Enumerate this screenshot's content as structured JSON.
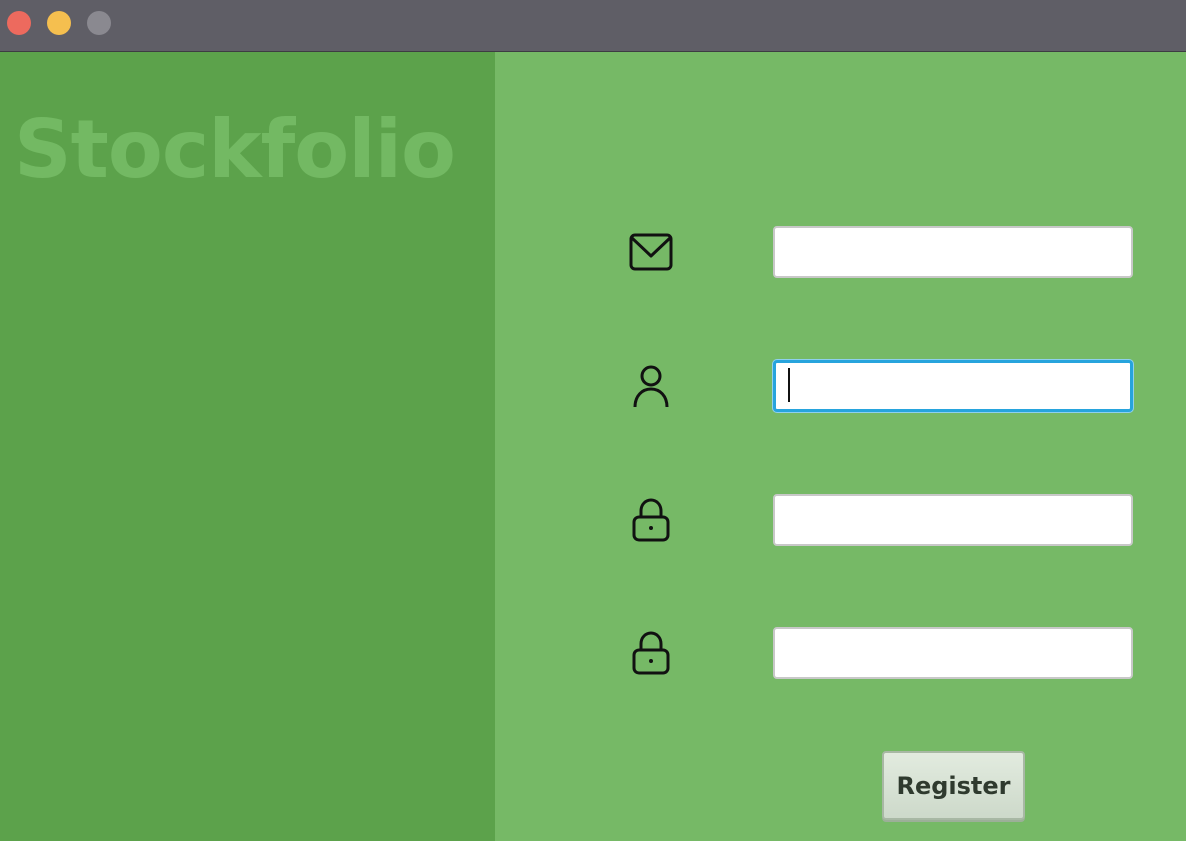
{
  "window": {
    "controls": [
      {
        "name": "close",
        "color": "#ed6a5e"
      },
      {
        "name": "minimize",
        "color": "#f5bf4f"
      },
      {
        "name": "zoom",
        "color": "#8a8990"
      }
    ]
  },
  "brand": {
    "title": "Stockfolio"
  },
  "form": {
    "fields": [
      {
        "icon": "envelope-icon",
        "value": "",
        "focused": false
      },
      {
        "icon": "user-icon",
        "value": "",
        "focused": true
      },
      {
        "icon": "lock-icon",
        "value": "",
        "focused": false
      },
      {
        "icon": "lock-icon",
        "value": "",
        "focused": false
      }
    ],
    "register_label": "Register"
  },
  "colors": {
    "brand_panel": "#5ca24b",
    "form_panel": "#76b966",
    "focus_ring": "#27a4dd"
  }
}
